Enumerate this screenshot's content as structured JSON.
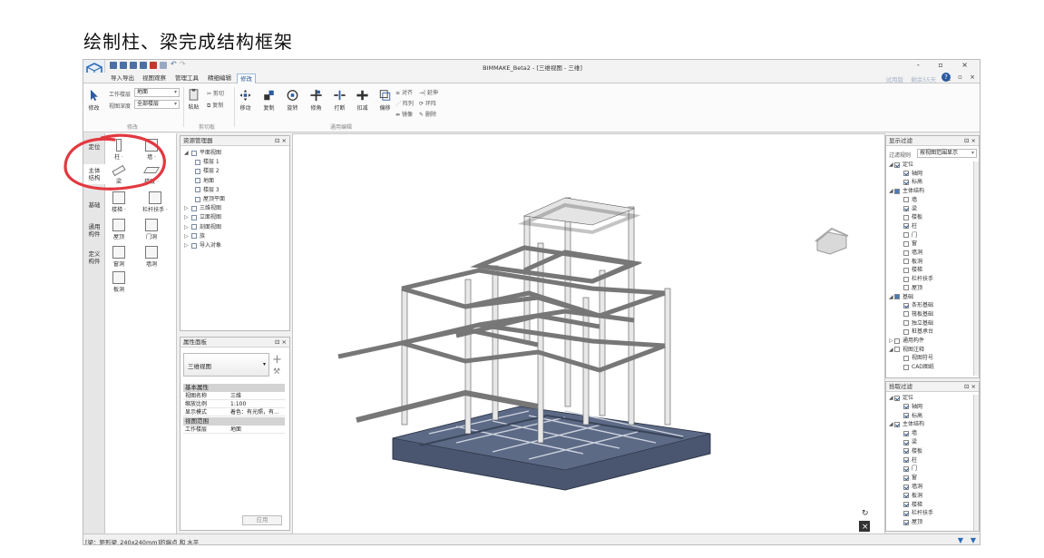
{
  "slide_title": "绘制柱、梁完成结构框架",
  "window": {
    "title": "BIMMAKE_Beta2 - [三维视图 - 三维]",
    "controls": "- ▫ ×",
    "trial": "试用版",
    "remaining": "剩余55天",
    "help": "?",
    "right_controls": "_ ▫ ×"
  },
  "menu_tabs": [
    {
      "label": "导入导出"
    },
    {
      "label": "视图观察"
    },
    {
      "label": "管理工具"
    },
    {
      "label": "精细编辑"
    },
    {
      "label": "修改",
      "active": true
    }
  ],
  "ribbon": {
    "modify_label": "修改",
    "work_floor_label": "工作楼层",
    "work_floor_value": "地面",
    "view_depth_label": "视图深度",
    "view_depth_value": "全部楼层",
    "group_modify": "修改",
    "paste": "粘贴",
    "cut": "剪切",
    "copy_small": "复制",
    "group_clipboard": "剪切板",
    "tools": [
      "移动",
      "复制",
      "旋转",
      "修角",
      "打断",
      "扣减",
      "偏移"
    ],
    "align": "对齐",
    "extend": "延伸",
    "array": "阵列",
    "ring": "环阵",
    "mirror": "镜像",
    "delete": "删除",
    "group_edit": "通用编辑"
  },
  "left_nav": [
    {
      "label": "定位"
    },
    {
      "label": "主体\n结构",
      "selected": true
    },
    {
      "label": "基础"
    },
    {
      "label": "通用\n构件"
    },
    {
      "label": "定义\n构件"
    }
  ],
  "palette": [
    {
      "label": "柱 ·",
      "icon": "column-icon"
    },
    {
      "label": "墙 ·",
      "icon": "wall-icon"
    },
    {
      "label": "梁",
      "icon": "beam-icon"
    },
    {
      "label": "楼板 ·",
      "icon": "slab-icon"
    },
    {
      "label": "楼梯 ·",
      "icon": "stair-icon"
    },
    {
      "label": "栏杆扶手 ·",
      "icon": "railing-icon"
    },
    {
      "label": "屋顶",
      "icon": "roof-icon"
    },
    {
      "label": "门洞",
      "icon": "door-opening-icon"
    },
    {
      "label": "窗洞",
      "icon": "window-opening-icon"
    },
    {
      "label": "墙洞",
      "icon": "wall-opening-icon"
    },
    {
      "label": "板洞",
      "icon": "slab-opening-icon"
    }
  ],
  "resource_manager": {
    "title": "资源管理器",
    "pin": "⊡ ×",
    "tree": [
      {
        "label": "平面视图",
        "level": 0,
        "expand": "◢"
      },
      {
        "label": "楼层 1",
        "level": 1
      },
      {
        "label": "楼层 2",
        "level": 1
      },
      {
        "label": "地面",
        "level": 1
      },
      {
        "label": "楼层 3",
        "level": 1
      },
      {
        "label": "屋顶平面",
        "level": 1
      },
      {
        "label": "三维视图",
        "level": 0,
        "expand": "▷"
      },
      {
        "label": "立面视图",
        "level": 0,
        "expand": "▷"
      },
      {
        "label": "剖面视图",
        "level": 0,
        "expand": "▷"
      },
      {
        "label": "族",
        "level": 0,
        "expand": "▷"
      },
      {
        "label": "导入对象",
        "level": 0,
        "expand": "▷"
      }
    ]
  },
  "properties": {
    "title": "属性面板",
    "pin": "⊡ ×",
    "type_value": "三维视图",
    "section_basic": "基本属性",
    "rows": [
      {
        "k": "视图名称",
        "v": "三维"
      },
      {
        "k": "缩放比例",
        "v": "1:100"
      },
      {
        "k": "显示模式",
        "v": "着色：有光照，有..."
      }
    ],
    "section_range": "视图范围",
    "rows2": [
      {
        "k": "工作楼层",
        "v": "地面"
      }
    ],
    "apply": "应用"
  },
  "display_filter": {
    "title": "显示过滤",
    "pin": "⊡ ×",
    "rule_label": "过滤规则",
    "rule_value": "按视图范围显示",
    "items": [
      {
        "label": "定位",
        "level": 0,
        "state": "on",
        "expand": "◢"
      },
      {
        "label": "轴网",
        "level": 1,
        "state": "on"
      },
      {
        "label": "标高",
        "level": 1,
        "state": "on"
      },
      {
        "label": "主体结构",
        "level": 0,
        "state": "part",
        "expand": "◢"
      },
      {
        "label": "墙",
        "level": 1,
        "state": "off"
      },
      {
        "label": "梁",
        "level": 1,
        "state": "on"
      },
      {
        "label": "楼板",
        "level": 1,
        "state": "off"
      },
      {
        "label": "柱",
        "level": 1,
        "state": "on"
      },
      {
        "label": "门",
        "level": 1,
        "state": "off"
      },
      {
        "label": "窗",
        "level": 1,
        "state": "off"
      },
      {
        "label": "墙洞",
        "level": 1,
        "state": "off"
      },
      {
        "label": "板洞",
        "level": 1,
        "state": "off"
      },
      {
        "label": "楼梯",
        "level": 1,
        "state": "off"
      },
      {
        "label": "栏杆扶手",
        "level": 1,
        "state": "off"
      },
      {
        "label": "屋顶",
        "level": 1,
        "state": "off"
      },
      {
        "label": "基础",
        "level": 0,
        "state": "part",
        "expand": "◢"
      },
      {
        "label": "条形基础",
        "level": 1,
        "state": "on"
      },
      {
        "label": "筏板基础",
        "level": 1,
        "state": "off"
      },
      {
        "label": "独立基础",
        "level": 1,
        "state": "off"
      },
      {
        "label": "桩基承台",
        "level": 1,
        "state": "off"
      },
      {
        "label": "通用构件",
        "level": 0,
        "state": "off",
        "expand": "▷"
      },
      {
        "label": "视图注释",
        "level": 0,
        "state": "off",
        "expand": "◢"
      },
      {
        "label": "视图符号",
        "level": 1,
        "state": "off"
      },
      {
        "label": "CAD图纸",
        "level": 1,
        "state": "off"
      }
    ]
  },
  "pick_filter": {
    "title": "拾取过滤",
    "pin": "⊡ ×",
    "items": [
      {
        "label": "定位",
        "level": 0,
        "state": "on",
        "expand": "◢"
      },
      {
        "label": "轴网",
        "level": 1,
        "state": "on"
      },
      {
        "label": "标高",
        "level": 1,
        "state": "on"
      },
      {
        "label": "主体结构",
        "level": 0,
        "state": "on",
        "expand": "◢"
      },
      {
        "label": "墙",
        "level": 1,
        "state": "on"
      },
      {
        "label": "梁",
        "level": 1,
        "state": "on"
      },
      {
        "label": "楼板",
        "level": 1,
        "state": "on"
      },
      {
        "label": "柱",
        "level": 1,
        "state": "on"
      },
      {
        "label": "门",
        "level": 1,
        "state": "on"
      },
      {
        "label": "窗",
        "level": 1,
        "state": "on"
      },
      {
        "label": "墙洞",
        "level": 1,
        "state": "on"
      },
      {
        "label": "板洞",
        "level": 1,
        "state": "on"
      },
      {
        "label": "楼梯",
        "level": 1,
        "state": "on"
      },
      {
        "label": "栏杆扶手",
        "level": 1,
        "state": "on"
      },
      {
        "label": "屋顶",
        "level": 1,
        "state": "on"
      }
    ]
  },
  "status_text": "[梁：矩形梁_240x240mm]的端点 和 水平",
  "colors": {
    "accent": "#2d6bb5",
    "foundation": "#4a5670",
    "frame": "#e4e4e4",
    "annotation": "#e2383f"
  }
}
